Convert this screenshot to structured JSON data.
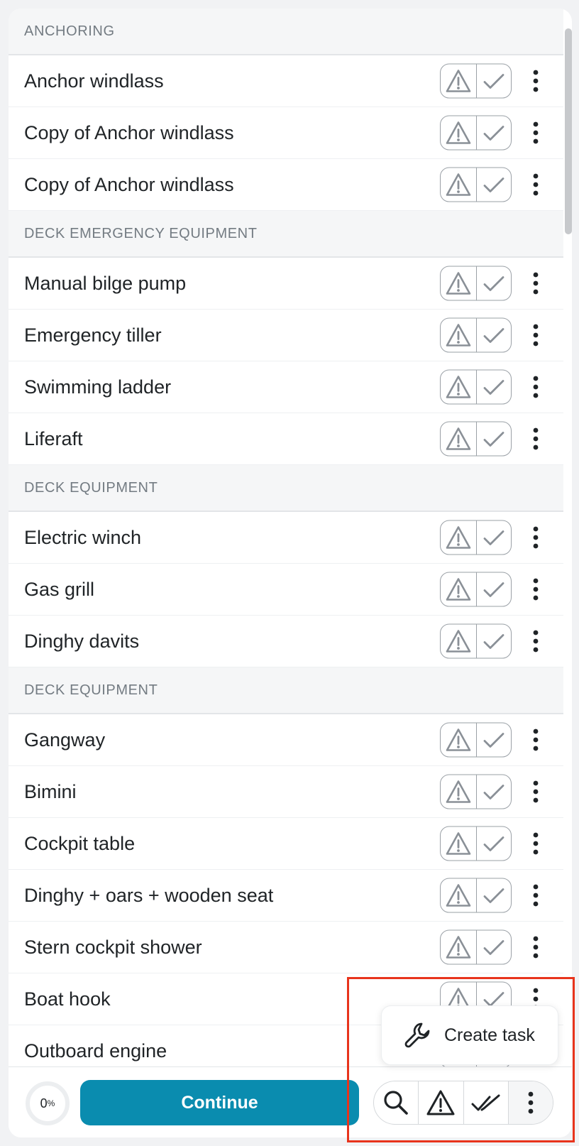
{
  "sections": [
    {
      "header": "ANCHORING",
      "items": [
        "Anchor windlass",
        "Copy of Anchor windlass",
        "Copy of Anchor windlass"
      ]
    },
    {
      "header": "DECK EMERGENCY EQUIPMENT",
      "items": [
        "Manual bilge pump",
        "Emergency tiller",
        "Swimming ladder",
        "Liferaft"
      ]
    },
    {
      "header": "DECK EQUIPMENT",
      "items": [
        "Electric winch",
        "Gas grill",
        "Dinghy davits"
      ]
    },
    {
      "header": "DECK EQUIPMENT",
      "items": [
        "Gangway",
        "Bimini",
        "Cockpit table",
        "Dinghy + oars + wooden seat",
        "Stern cockpit shower",
        "Boat hook",
        "Outboard engine"
      ]
    }
  ],
  "bottom_bar": {
    "progress_value": "0",
    "progress_unit": "%",
    "continue_label": "Continue",
    "toolbar_icons": [
      "search-icon",
      "warning-icon",
      "double-check-icon",
      "more-vertical-icon"
    ]
  },
  "popup_menu": {
    "icon": "wrench-icon",
    "label": "Create task"
  },
  "colors": {
    "accent": "#0a8caf",
    "highlight": "#e8341c",
    "section_bg": "#f5f6f7"
  }
}
